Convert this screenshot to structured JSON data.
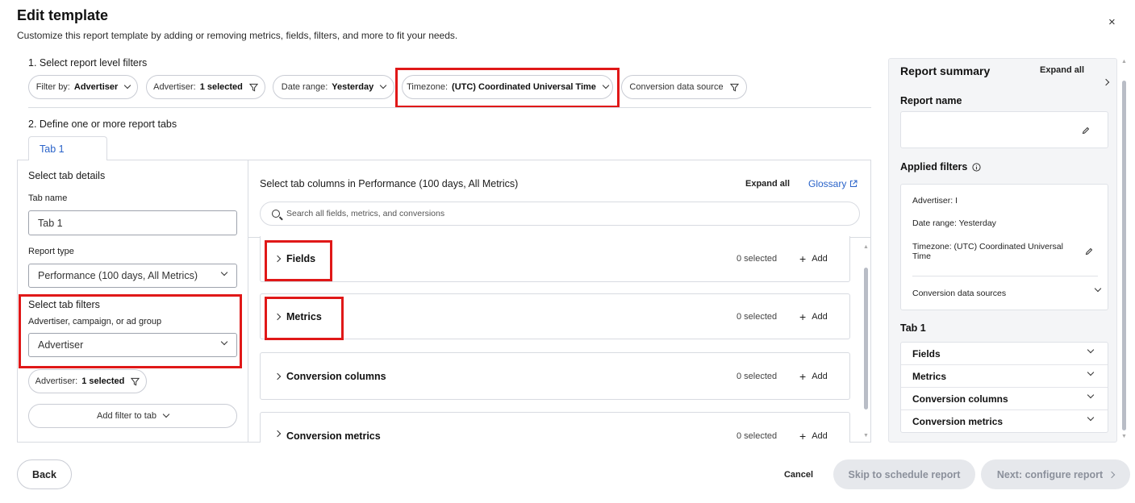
{
  "header": {
    "title": "Edit template",
    "subtitle": "Customize this report template by adding or removing metrics, fields, filters, and more to fit your needs.",
    "close": "×"
  },
  "report_filters": {
    "label": "1. Select report level filters",
    "filter_by": {
      "prefix": "Filter by:",
      "value": "Advertiser"
    },
    "advertiser": {
      "prefix": "Advertiser:",
      "value": "1 selected"
    },
    "date_range": {
      "prefix": "Date range:",
      "value": "Yesterday"
    },
    "timezone": {
      "prefix": "Timezone:",
      "value": "(UTC) Coordinated Universal Time"
    },
    "conversion": {
      "label": "Conversion data source"
    }
  },
  "tabs": {
    "label": "2. Define one or more report tabs",
    "items": [
      {
        "label": "Tab 1"
      }
    ]
  },
  "tab_details": {
    "heading": "Select tab details",
    "tab_name_label": "Tab name",
    "tab_name_value": "Tab 1",
    "report_type_label": "Report type",
    "report_type_value": "Performance (100 days, All Metrics)",
    "tab_filters_heading": "Select tab filters",
    "tab_filters_sub": "Advertiser, campaign, or ad group",
    "tab_filter_value": "Advertiser",
    "advertiser_pill": {
      "prefix": "Advertiser:",
      "value": "1 selected"
    },
    "add_filter": "Add filter to tab"
  },
  "columns": {
    "heading": "Select tab columns in Performance (100 days, All Metrics)",
    "expand_all": "Expand all",
    "glossary": "Glossary",
    "search_placeholder": "Search all fields, metrics, and conversions",
    "sections": [
      {
        "title": "Fields",
        "count": "0 selected",
        "add": "Add"
      },
      {
        "title": "Metrics",
        "count": "0 selected",
        "add": "Add"
      },
      {
        "title": "Conversion columns",
        "count": "0 selected",
        "add": "Add"
      },
      {
        "title": "Conversion metrics",
        "count": "0 selected",
        "add": "Add"
      }
    ]
  },
  "summary": {
    "title": "Report summary",
    "expand_all": "Expand all",
    "report_name_label": "Report name",
    "applied_filters_label": "Applied filters",
    "filters": {
      "advertiser": "Advertiser: I",
      "date_range": "Date range: Yesterday",
      "timezone": "Timezone: (UTC) Coordinated Universal Time",
      "conversion": "Conversion data sources"
    },
    "tab_label": "Tab 1",
    "tab_sections": [
      "Fields",
      "Metrics",
      "Conversion columns",
      "Conversion metrics"
    ]
  },
  "footer": {
    "back": "Back",
    "cancel": "Cancel",
    "skip": "Skip to schedule report",
    "next": "Next: configure report"
  },
  "colors": {
    "accent_blue": "#2a63c9",
    "highlight_red": "#e01818",
    "disabled_bg": "#e6e8ec",
    "disabled_text": "#8b909b"
  }
}
